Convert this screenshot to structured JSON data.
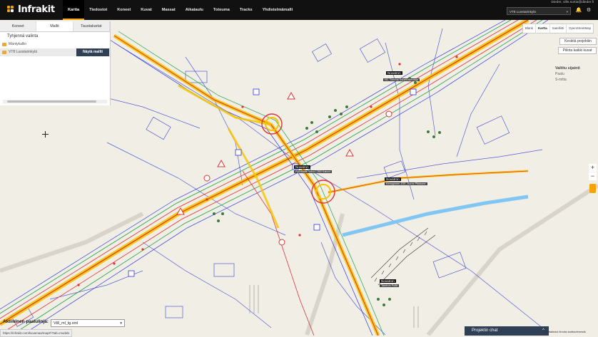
{
  "app": {
    "name": "Infrakit"
  },
  "header": {
    "user_line": "Dieder, ville.surtia@dieder.fi",
    "nav": [
      "Kartta",
      "Tiedostot",
      "Koneet",
      "Kuvat",
      "Massat",
      "Aikataulu",
      "Toteuma",
      "Tracks",
      "Yhdistelmämalli"
    ],
    "active_nav": "Kartta",
    "project": "VT8 Luostarinkylä",
    "icons": [
      "bell-icon",
      "gear-icon"
    ]
  },
  "left_panel": {
    "tabs": [
      "Koneet",
      "Mallit",
      "Taustakartat"
    ],
    "active_tab": "Mallit",
    "clear_selection": "Tyhjennä valinta",
    "items": [
      {
        "label": "Mäntykallio"
      },
      {
        "label": "VT8 Luostarinkylä",
        "selected": true
      }
    ],
    "show_models_button": "Näytä mallit"
  },
  "map_controls": {
    "map_types": [
      "Blank",
      "Kartta",
      "Satelliitti",
      "OpenStreetMap"
    ],
    "active_map_type": "Kartta",
    "center_projection": "Keskitä projektiin",
    "hide_all_layers": "Piilota kaikki kuvat",
    "selected_location": {
      "title": "Valittu sijainti",
      "line1": "Paalu",
      "line2": "S-mitta"
    },
    "zoom_in": "+",
    "zoom_out": "−"
  },
  "map_labels": {
    "novatron": "Novatron",
    "machines": [
      "Novatron",
      "Novatron",
      "Novatron",
      "Novatron"
    ],
    "machine_details": [
      "N1, Tumma Sepelirakentaja",
      "Pyörälaite Volvo L350 Kaivuri",
      "Kemppinen JOE, Eurox Pitokone",
      "Tamtron Pultti"
    ]
  },
  "bottom": {
    "active_line_label": "Aktiivinen paalulinja:",
    "active_line_value": "Vt8_ml_tg.xml",
    "status_url": "https://infrakit.com/kuvamaa/map#/?tab=models",
    "chat": "Projektin chat",
    "footer_links": "Karttatiedot   Ilmoita karttavirheestä"
  },
  "colors": {
    "topbar": "#111111",
    "accent": "#f4a300",
    "navy": "#2f3f55",
    "map_bg": "#f1eee6",
    "road_red": "#e03232",
    "road_yellow": "#f5c400",
    "road_blue": "#2b36e0",
    "road_green": "#1fa14a"
  }
}
